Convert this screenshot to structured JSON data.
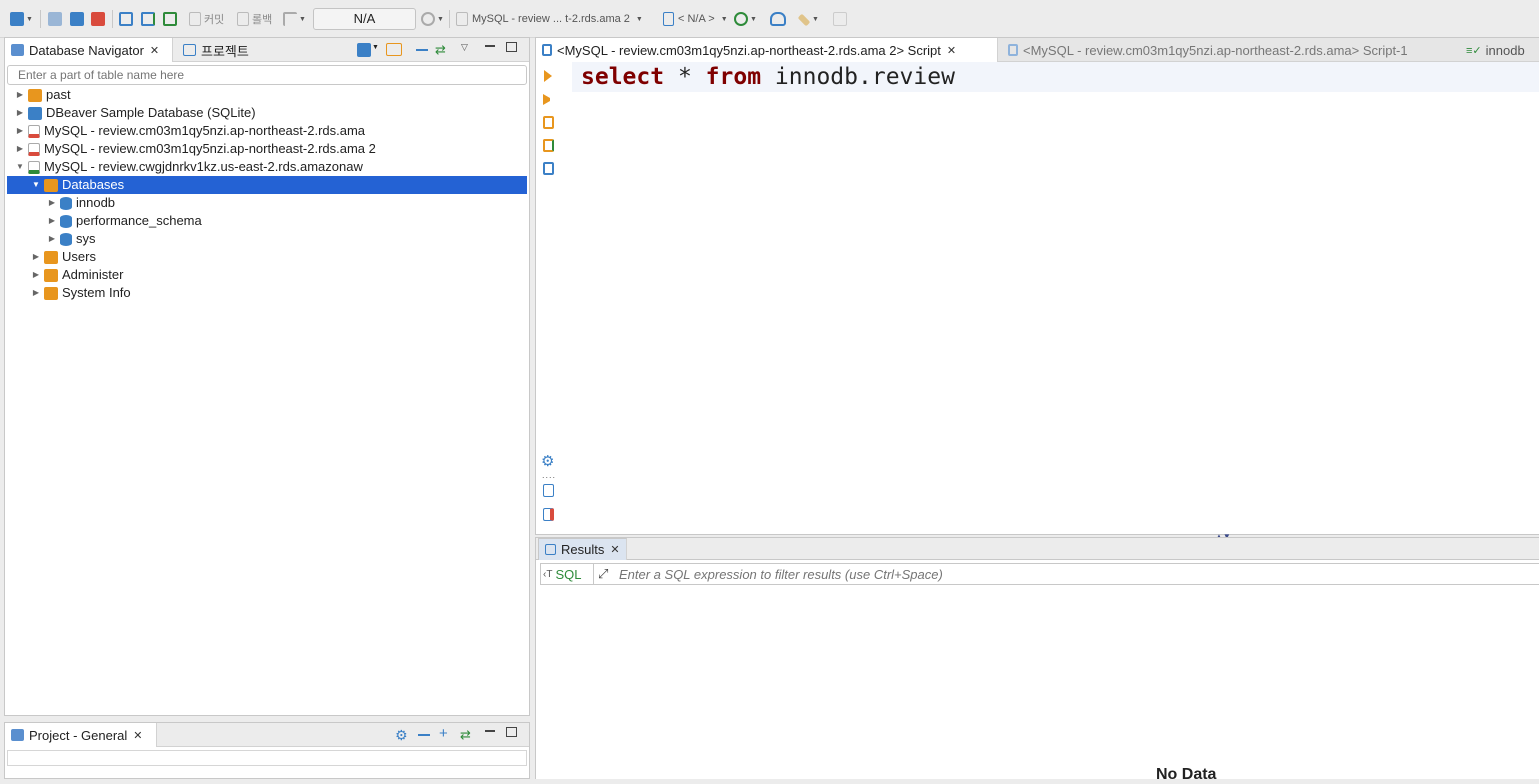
{
  "toolbar": {
    "commit_label": "커밋",
    "rollback_label": "롤백",
    "transaction_mode": "N/A",
    "active_connection": "MySQL - review ... t-2.rds.ama 2",
    "active_schema": "< N/A >"
  },
  "navigator": {
    "tab_label": "Database Navigator",
    "project_tab_label": "프로젝트",
    "filter_placeholder": "Enter a part of table name here",
    "tree": [
      {
        "label": "past",
        "level": 0,
        "expanded": false,
        "icon": "folder-icon"
      },
      {
        "label": "DBeaver Sample Database (SQLite)",
        "level": 0,
        "expanded": false,
        "icon": "sqlite-icon"
      },
      {
        "label": "MySQL - review.cm03m1qy5nzi.ap-northeast-2.rds.ama",
        "level": 0,
        "expanded": false,
        "icon": "mysql-disconnected-icon"
      },
      {
        "label": "MySQL - review.cm03m1qy5nzi.ap-northeast-2.rds.ama 2",
        "level": 0,
        "expanded": false,
        "icon": "mysql-disconnected-icon"
      },
      {
        "label": "MySQL - review.cwgjdnrkv1kz.us-east-2.rds.amazonaw",
        "level": 0,
        "expanded": true,
        "icon": "mysql-connected-icon"
      },
      {
        "label": "Databases",
        "level": 1,
        "expanded": true,
        "icon": "databases-folder-icon",
        "selected": true
      },
      {
        "label": "innodb",
        "level": 2,
        "expanded": false,
        "icon": "database-icon"
      },
      {
        "label": "performance_schema",
        "level": 2,
        "expanded": false,
        "icon": "database-icon"
      },
      {
        "label": "sys",
        "level": 2,
        "expanded": false,
        "icon": "database-icon"
      },
      {
        "label": "Users",
        "level": 1,
        "expanded": false,
        "icon": "users-folder-icon"
      },
      {
        "label": "Administer",
        "level": 1,
        "expanded": false,
        "icon": "administer-folder-icon"
      },
      {
        "label": "System Info",
        "level": 1,
        "expanded": false,
        "icon": "sysinfo-folder-icon"
      }
    ]
  },
  "project_panel": {
    "tab_label": "Project - General"
  },
  "editor": {
    "tabs": [
      {
        "label": "<MySQL - review.cm03m1qy5nzi.ap-northeast-2.rds.ama 2> Script"
      },
      {
        "label": "<MySQL - review.cm03m1qy5nzi.ap-northeast-2.rds.ama> Script-1"
      },
      {
        "label": "innodb"
      }
    ],
    "sql": {
      "kw_select": "select",
      "star": "*",
      "kw_from": "from",
      "table": "innodb.review"
    }
  },
  "results": {
    "tab_label": "Results",
    "sql_button": "SQL",
    "filter_placeholder": "Enter a SQL expression to filter results (use Ctrl+Space)",
    "empty_message": "No Data"
  },
  "colors": {
    "selection": "#2462d4",
    "keyword": "#7f0000",
    "accent_blue": "#3b80c6",
    "accent_green": "#2e8b3a",
    "accent_orange": "#e8961e"
  }
}
